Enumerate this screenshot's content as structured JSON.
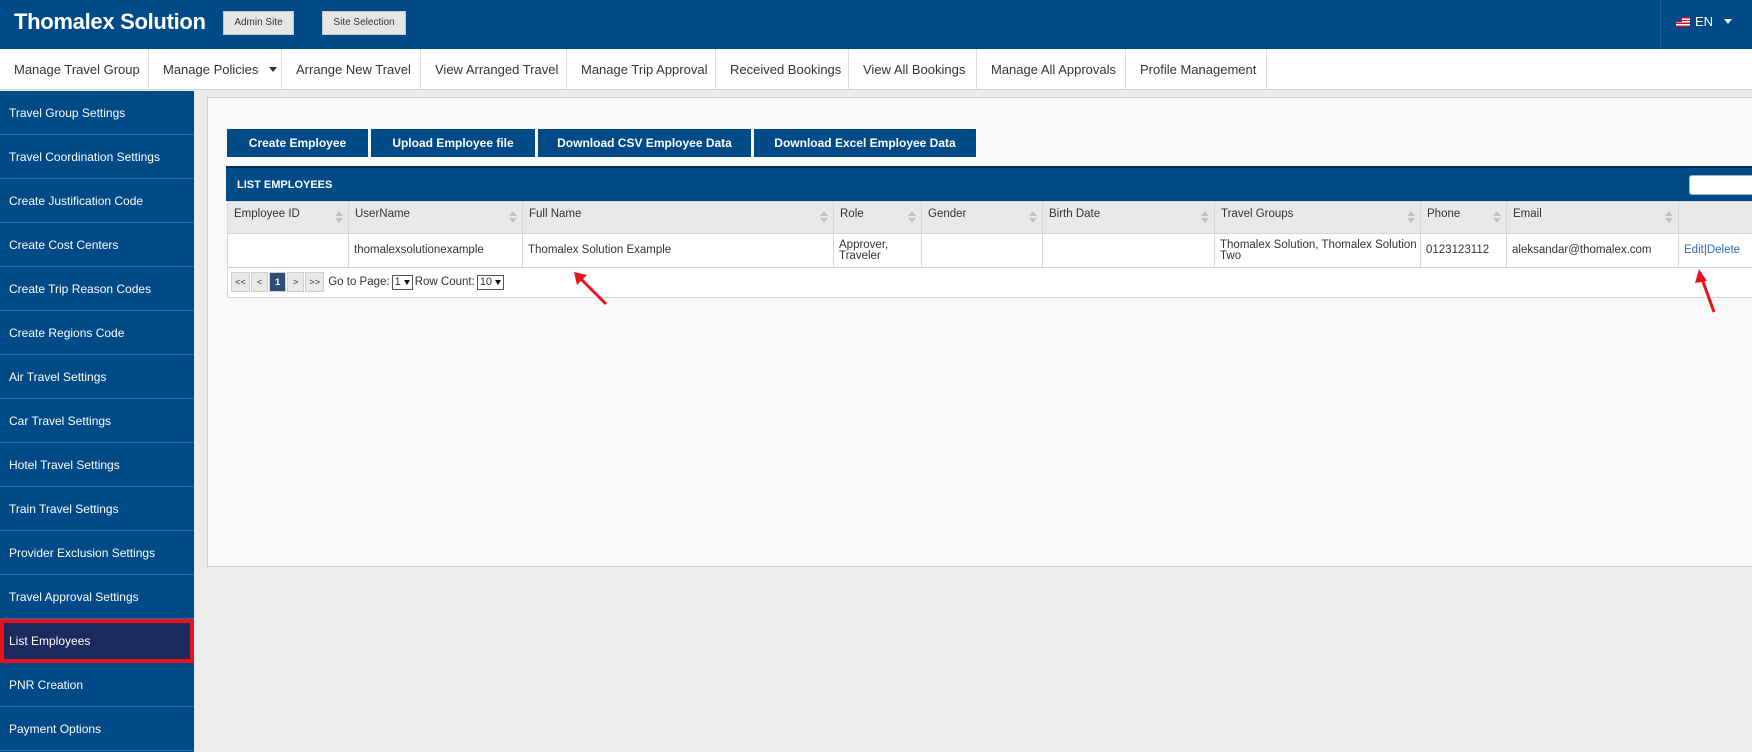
{
  "brand": "Thomalex Solution",
  "topbar": {
    "admin_site": "Admin Site",
    "site_selection": "Site Selection",
    "language": "EN"
  },
  "menu": [
    {
      "label": "Manage Travel Group"
    },
    {
      "label": "Manage Policies",
      "dropdown": true
    },
    {
      "label": "Arrange New Travel"
    },
    {
      "label": "View Arranged Travel"
    },
    {
      "label": "Manage Trip Approval"
    },
    {
      "label": "Received Bookings"
    },
    {
      "label": "View All Bookings"
    },
    {
      "label": "Manage All Approvals"
    },
    {
      "label": "Profile Management"
    }
  ],
  "sidebar": [
    "Travel Group Settings",
    "Travel Coordination Settings",
    "Create Justification Code",
    "Create Cost Centers",
    "Create Trip Reason Codes",
    "Create Regions Code",
    "Air Travel Settings",
    "Car Travel Settings",
    "Hotel Travel Settings",
    "Train Travel Settings",
    "Provider Exclusion Settings",
    "Travel Approval Settings",
    "List Employees",
    "PNR Creation",
    "Payment Options"
  ],
  "sidebar_active": "List Employees",
  "actions": {
    "create": "Create Employee",
    "upload": "Upload Employee file",
    "csv": "Download CSV Employee Data",
    "excel": "Download Excel Employee Data"
  },
  "list_title": "LIST EMPLOYEES",
  "columns": [
    "Employee ID",
    "UserName",
    "Full Name",
    "Role",
    "Gender",
    "Birth Date",
    "Travel Groups",
    "Phone",
    "Email"
  ],
  "rows": [
    {
      "employee_id": "",
      "username": "thomalexsolutionexample",
      "full_name": "Thomalex Solution Example",
      "role": "Approver, Traveler",
      "gender": "",
      "birth_date": "",
      "travel_groups": "Thomalex Solution, Thomalex Solution Two",
      "phone": "0123123112",
      "email": "aleksandar@thomalex.com",
      "edit": "Edit",
      "delete": "Delete"
    }
  ],
  "pager": {
    "first": "<<",
    "prev": "<",
    "current": "1",
    "next": ">",
    "last": ">>",
    "goto_label": "Go to Page:",
    "page_value": "1",
    "rowcount_label": "Row Count:",
    "rowcount_value": "10"
  },
  "colors": {
    "brand_blue": "#004a87",
    "active_item": "#1c2b5e",
    "highlight_red": "#e8131c",
    "link": "#2a6bb5"
  }
}
